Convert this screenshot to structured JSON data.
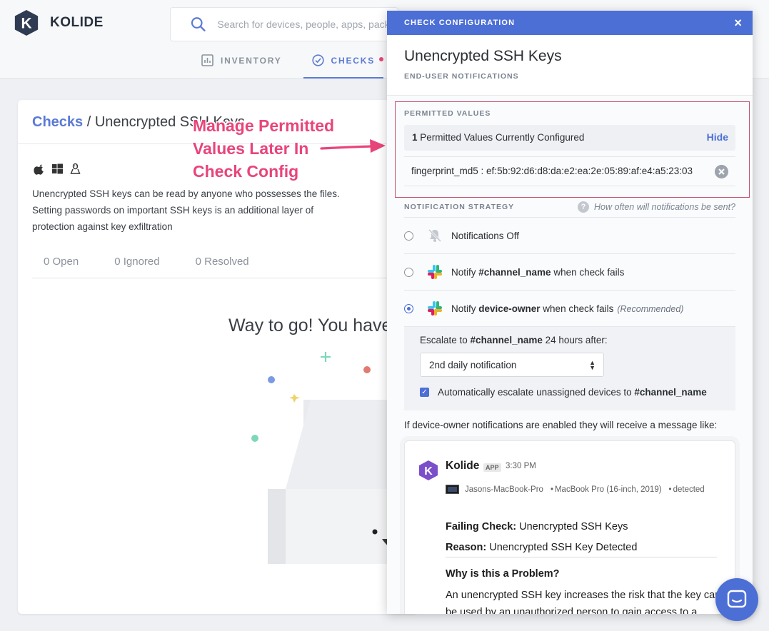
{
  "app": {
    "logo_text": "KOLIDE",
    "accent_color": "#4c6fd6",
    "annotation_color": "#e8457a"
  },
  "search": {
    "placeholder": "Search for devices, people, apps, packages"
  },
  "nav": {
    "tabs": [
      {
        "label": "INVENTORY",
        "icon": "inventory-icon"
      },
      {
        "label": "CHECKS",
        "icon": "checks-icon",
        "active": true,
        "has_dot": true
      }
    ]
  },
  "page": {
    "breadcrumb_link": "Checks",
    "breadcrumb_sep": " / ",
    "breadcrumb_current": "Unencrypted SSH Keys",
    "description": "Unencrypted SSH keys can be read by anyone who possesses the files. Setting passwords on important SSH keys is an additional layer of protection against key exfiltration",
    "tabs": [
      "0 Open",
      "0 Ignored",
      "0 Resolved"
    ],
    "empty_message": "Way to go! You have no failing devices!"
  },
  "annotation": {
    "text": "Manage Permitted\nValues Later In\nCheck Config"
  },
  "modal": {
    "header": "CHECK CONFIGURATION",
    "close": "×",
    "title": "Unencrypted SSH Keys",
    "subtitle": "END-USER NOTIFICATIONS",
    "permitted_values": {
      "label": "PERMITTED VALUES",
      "count": "1",
      "count_text": "Permitted Values Currently Configured",
      "hide_label": "Hide",
      "items": [
        "fingerprint_md5 : ef:5b:92:d6:d8:da:e2:ea:2e:05:89:af:e4:a5:23:03"
      ]
    },
    "notification_strategy": {
      "label": "NOTIFICATION STRATEGY",
      "help": "How often will notifications be sent?",
      "options": [
        {
          "pre": "Notifications Off",
          "bold": "",
          "post": "",
          "rec": "",
          "icon": "bell-off-icon",
          "checked": false
        },
        {
          "pre": "Notify ",
          "bold": "#channel_name",
          "post": " when check fails",
          "rec": "",
          "icon": "slack-icon",
          "checked": false
        },
        {
          "pre": "Notify ",
          "bold": "device-owner",
          "post": " when check fails",
          "rec": "(Recommended)",
          "icon": "slack-icon",
          "checked": true
        }
      ]
    },
    "escalation": {
      "text_pre": "Escalate to ",
      "text_bold": "#channel_name",
      "text_post": " 24 hours after:",
      "select_value": "2nd daily notification",
      "checkbox_pre": "Automatically escalate unassigned devices to ",
      "checkbox_bold": "#channel_name",
      "checkbox_checked": true
    },
    "message_intro": "If device-owner notifications are enabled they will receive a message like:",
    "slack": {
      "sender": "Kolide",
      "app_badge": "APP",
      "time": "3:30 PM",
      "device_name": "Jasons-MacBook-Pro",
      "device_model": "MacBook Pro (16-inch, 2019)",
      "device_status": "detected",
      "failing_label": "Failing Check:",
      "failing_value": "Unencrypted SSH Keys",
      "reason_label": "Reason:",
      "reason_value": "Unencrypted SSH Key Detected",
      "why_title": "Why is this a Problem?",
      "why_body": "An unencrypted SSH key increases the risk that the key can be used by an unauthorized person to gain access to a"
    }
  }
}
